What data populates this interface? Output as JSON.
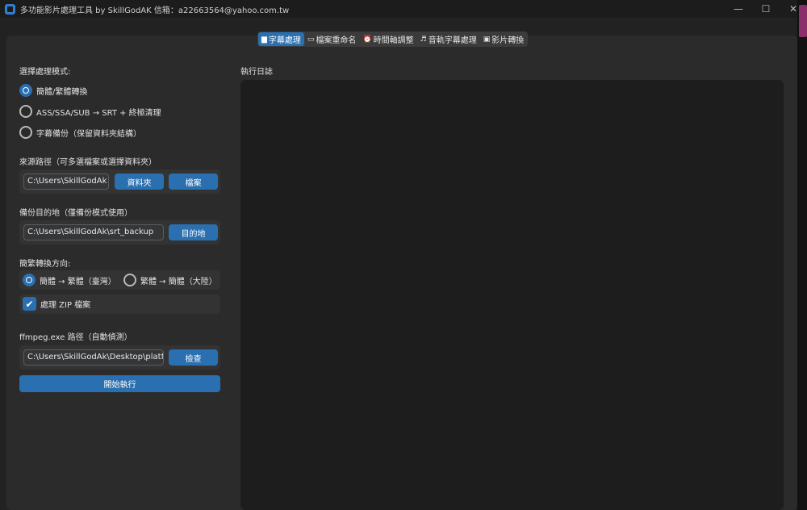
{
  "window": {
    "title": "多功能影片處理工具 by SkillGodAK  信箱：a22663564@yahoo.com.tw",
    "minimize": "—",
    "maximize": "☐",
    "close": "✕"
  },
  "tabs": [
    {
      "icon": "▆",
      "label": "字幕處理",
      "active": true
    },
    {
      "icon": "▭",
      "label": "檔案重命名",
      "active": false
    },
    {
      "icon": "⏰",
      "label": "時間軸調整",
      "active": false
    },
    {
      "icon": "♬",
      "label": "音軌字幕處理",
      "active": false
    },
    {
      "icon": "▣",
      "label": "影片轉換",
      "active": false
    }
  ],
  "mode": {
    "label": "選擇處理模式:",
    "options": [
      {
        "label": "簡體/繁體轉換",
        "selected": true
      },
      {
        "label": "ASS/SSA/SUB → SRT + 終極清理",
        "selected": false
      },
      {
        "label": "字幕備份（保留資料夾結構）",
        "selected": false
      }
    ]
  },
  "source": {
    "label": "來源路徑（可多選檔案或選擇資料夾）",
    "value": "C:\\Users\\SkillGodAk",
    "folder_button": "資料夾",
    "file_button": "檔案"
  },
  "backup": {
    "label": "備份目的地（僅備份模式使用）",
    "value": "C:\\Users\\SkillGodAk\\srt_backup",
    "dest_button": "目的地"
  },
  "conversion": {
    "label": "簡繁轉換方向:",
    "options": [
      {
        "label": "簡體 → 繁體（臺灣）",
        "selected": true
      },
      {
        "label": "繁體 → 簡體（大陸）",
        "selected": false
      }
    ],
    "zip_label": "處理 ZIP 檔案",
    "zip_checked": true
  },
  "ffmpeg": {
    "label": "ffmpeg.exe 路徑（自動偵測）",
    "value": "C:\\Users\\SkillGodAk\\Desktop\\platform",
    "check_button": "檢查"
  },
  "run_button": "開始執行",
  "log": {
    "label": "執行日誌"
  },
  "colors": {
    "accent": "#2a6fb0",
    "panel": "#2b2b2b",
    "log_bg": "#1d1d1d"
  }
}
